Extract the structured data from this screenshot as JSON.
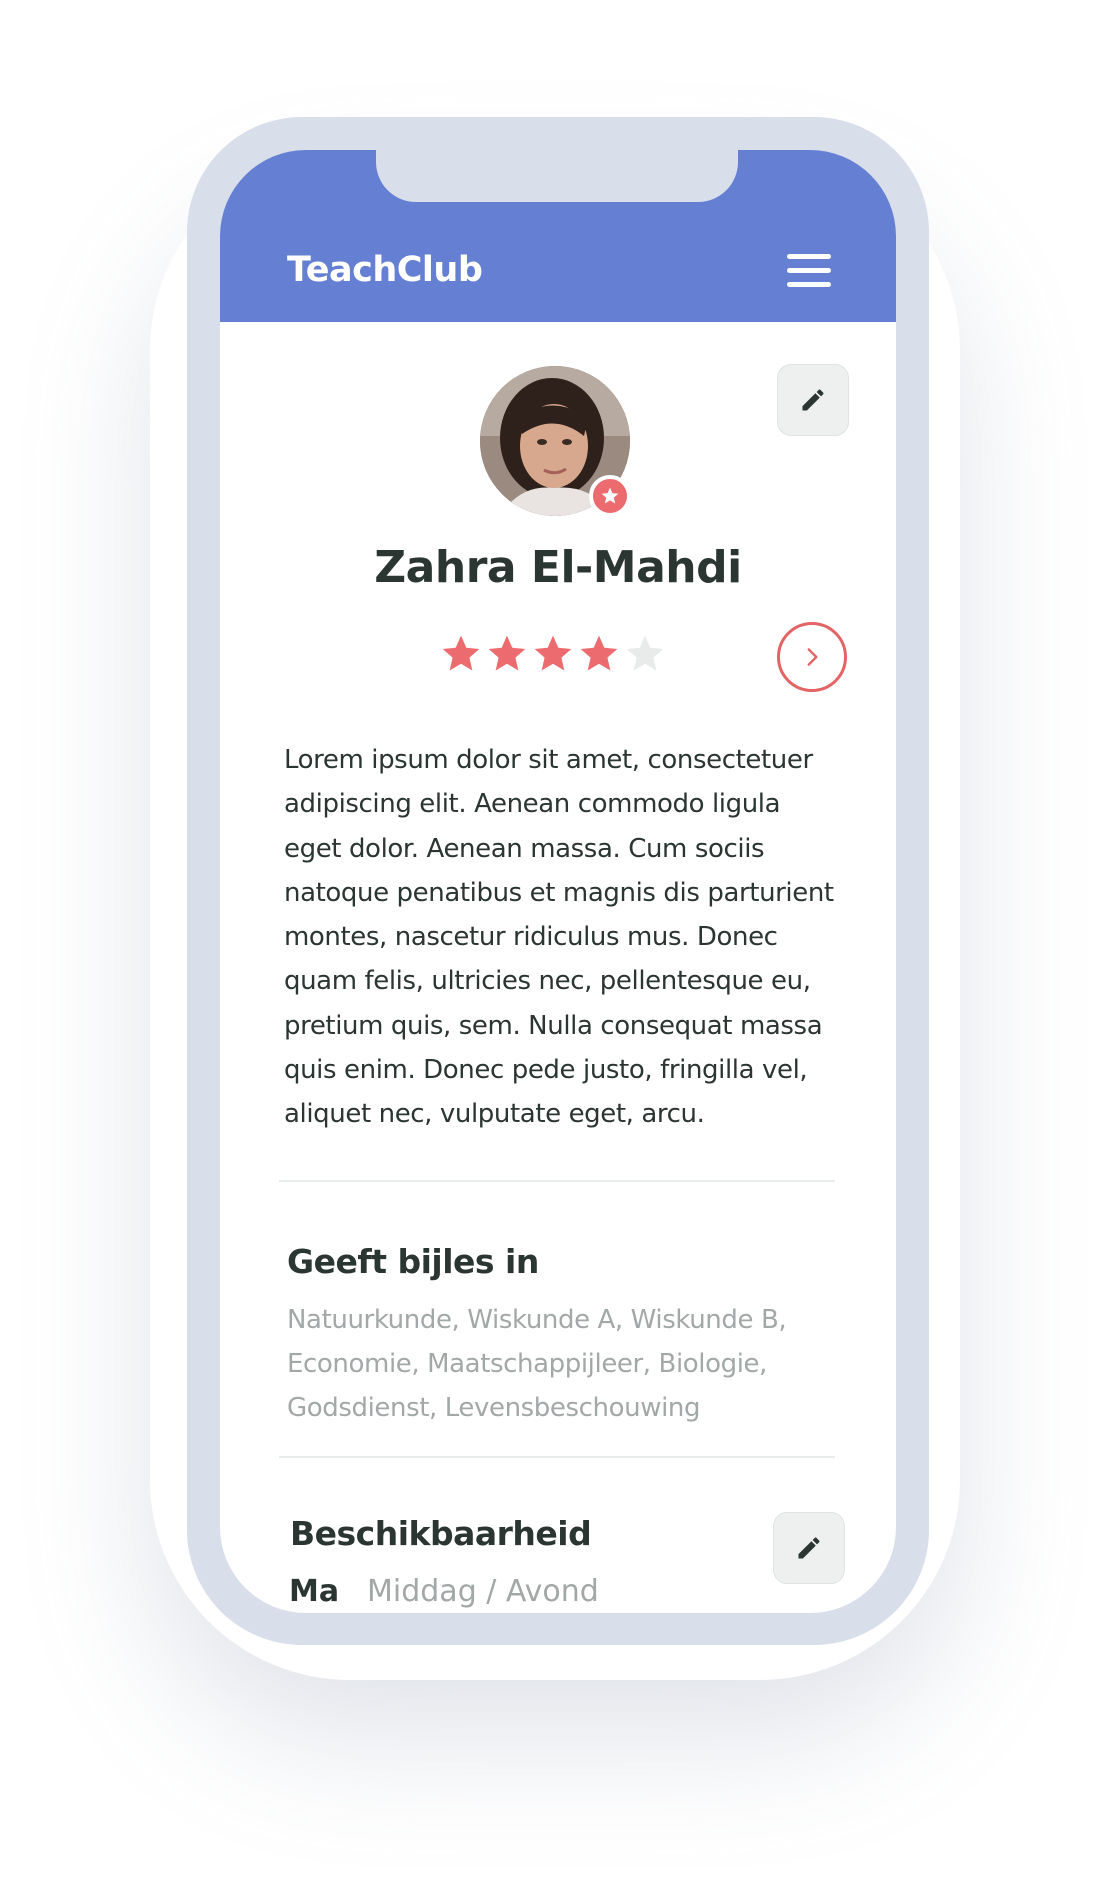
{
  "header": {
    "logo": "TeachClub",
    "menu_icon": "hamburger-icon"
  },
  "profile": {
    "name": "Zahra El-Mahdi",
    "rating": 4,
    "rating_max": 5,
    "badge_icon": "star-icon",
    "edit_icon": "pencil-icon",
    "detail_icon": "chevron-right-icon",
    "bio": "Lorem ipsum dolor sit amet, consectetuer adipiscing elit. Aenean commodo ligula eget dolor. Aenean massa. Cum sociis natoque penatibus et magnis dis parturient montes, nascetur ridiculus mus. Donec quam felis, ultricies nec, pellentesque eu, pretium quis, sem. Nulla consequat massa quis enim. Donec pede justo, fringilla vel, aliquet nec, vulputate eget, arcu."
  },
  "subjects": {
    "title": "Geeft bijles in",
    "list": "Natuurkunde, Wiskunde A, Wiskunde B, Economie, Maatschappijleer, Biologie, Godsdienst, Levensbeschouwing"
  },
  "availability": {
    "title": "Beschikbaarheid",
    "edit_icon": "pencil-icon",
    "rows": [
      {
        "day": "Ma",
        "value": "Middag / Avond"
      }
    ]
  },
  "colors": {
    "header": "#6580d2",
    "accent": "#ec6b6e",
    "device_frame": "#d8deea",
    "text": "#2b3532",
    "muted_text": "#a2a8a7"
  }
}
